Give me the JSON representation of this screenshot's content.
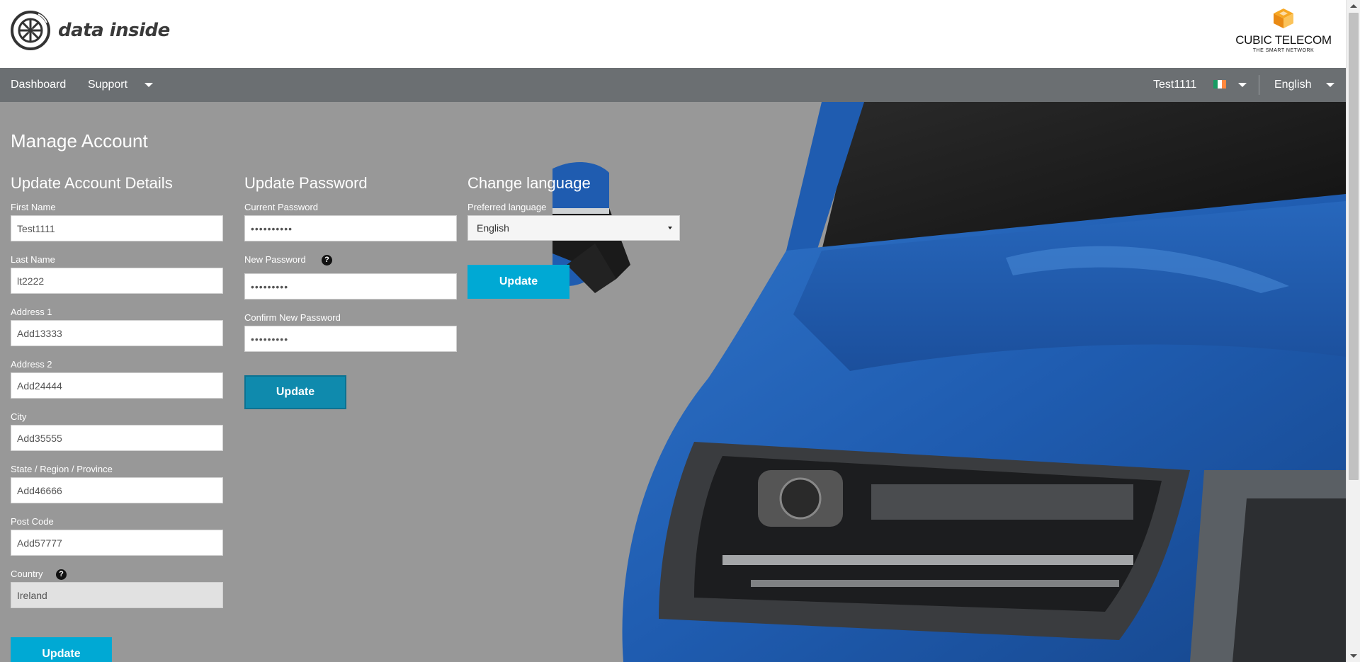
{
  "header": {
    "logo_text": "data inside",
    "brand_name": "CUBIC TELECOM",
    "brand_tagline": "THE SMART NETWORK"
  },
  "nav": {
    "dashboard": "Dashboard",
    "support": "Support",
    "user": "Test1111",
    "language": "English"
  },
  "page": {
    "title": "Manage Account"
  },
  "account": {
    "title": "Update Account Details",
    "first_name_label": "First Name",
    "first_name": "Test1111",
    "last_name_label": "Last Name",
    "last_name": "lt2222",
    "address1_label": "Address 1",
    "address1": "Add13333",
    "address2_label": "Address 2",
    "address2": "Add24444",
    "city_label": "City",
    "city": "Add35555",
    "state_label": "State / Region / Province",
    "state": "Add46666",
    "postcode_label": "Post Code",
    "postcode": "Add57777",
    "country_label": "Country",
    "country": "Ireland",
    "update_label": "Update"
  },
  "password": {
    "title": "Update Password",
    "current_label": "Current Password",
    "current_value": "••••••••••",
    "new_label": "New Password",
    "new_value": "•••••••••",
    "confirm_label": "Confirm New Password",
    "confirm_value": "•••••••••",
    "update_label": "Update"
  },
  "language": {
    "title": "Change language",
    "preferred_label": "Preferred language",
    "selected": "English",
    "update_label": "Update"
  },
  "icons": {
    "help": "?"
  },
  "colors": {
    "accent": "#00a9d4",
    "nav_bg": "#6b6f72",
    "main_bg": "#989898",
    "car_blue": "#1f5cb0"
  }
}
